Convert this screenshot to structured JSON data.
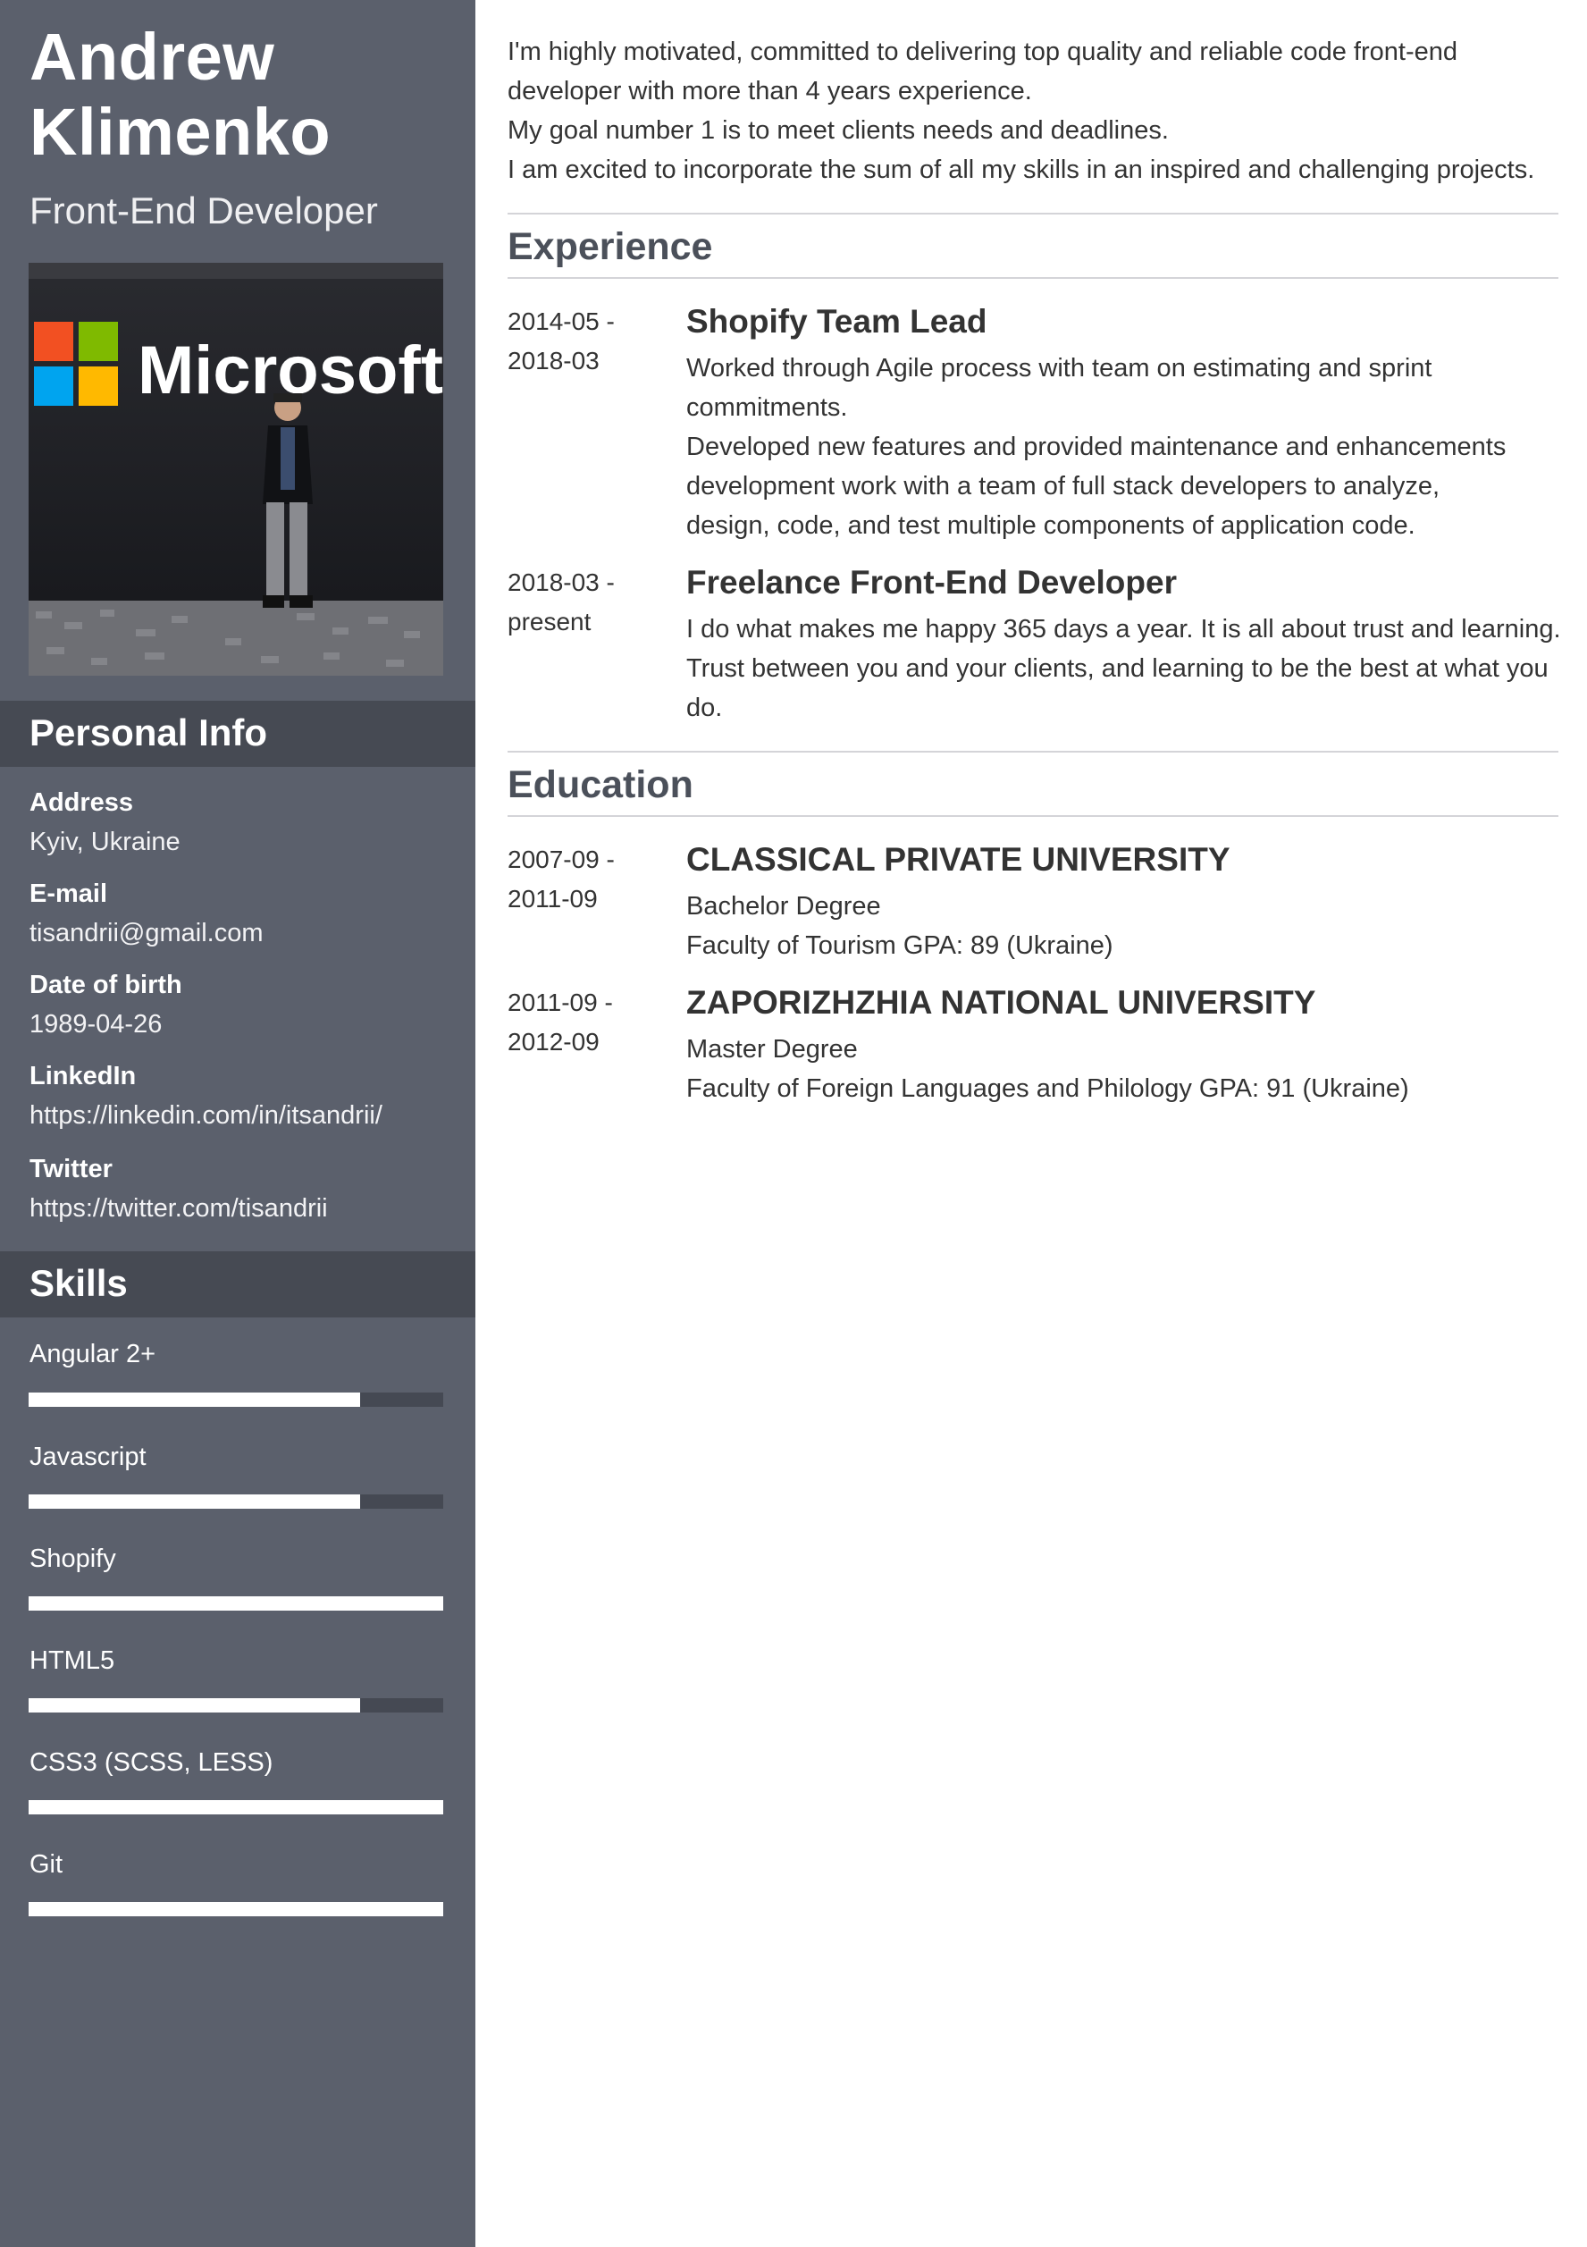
{
  "profile": {
    "name_line1": "Andrew",
    "name_line2": "Klimenko",
    "title": "Front-End Developer",
    "photo": {
      "description_icon": "profile-photo",
      "sign_text": "Microsoft",
      "logo_colors": [
        "#f25022",
        "#7fba00",
        "#00a4ef",
        "#ffb900"
      ]
    }
  },
  "personal_info": {
    "heading": "Personal Info",
    "items": [
      {
        "label": "Address",
        "value": "Kyiv, Ukraine"
      },
      {
        "label": "E-mail",
        "value": "tisandrii@gmail.com"
      },
      {
        "label": "Date of birth",
        "value": "1989-04-26"
      },
      {
        "label": "LinkedIn",
        "value": "https://linkedin.com/in/itsandrii/"
      },
      {
        "label": "Twitter",
        "value": "https://twitter.com/tisandrii"
      }
    ]
  },
  "skills": {
    "heading": "Skills",
    "items": [
      {
        "name": "Angular 2+",
        "level": 0.8
      },
      {
        "name": "Javascript",
        "level": 0.8
      },
      {
        "name": "Shopify",
        "level": 1.0
      },
      {
        "name": "HTML5",
        "level": 0.8
      },
      {
        "name": "CSS3 (SCSS, LESS)",
        "level": 1.0
      },
      {
        "name": "Git",
        "level": 1.0
      }
    ]
  },
  "summary": {
    "lines": [
      "I'm highly motivated, committed to delivering top quality and reliable code front-end",
      "developer with more than 4 years experience.",
      "My goal number 1 is to meet clients needs and deadlines.",
      "I am excited to incorporate the sum of all my skills in an inspired and challenging projects."
    ]
  },
  "experience": {
    "heading": "Experience",
    "entries": [
      {
        "date_line1": "2014-05 -",
        "date_line2": "2018-03",
        "title": "Shopify Team Lead",
        "lines": [
          "Worked through Agile process with team on estimating and sprint",
          "commitments.",
          "Developed new features and provided maintenance and enhancements",
          "development work with a team of full stack developers to analyze,",
          "design, code, and test multiple components of application code."
        ]
      },
      {
        "date_line1": "2018-03 -",
        "date_line2": "present",
        "title": "Freelance Front-End Developer",
        "lines": [
          "I do what makes me happy 365 days a year. It is all about trust and learning.",
          "Trust between you and your clients, and learning to be the best at what you",
          "do."
        ]
      }
    ]
  },
  "education": {
    "heading": "Education",
    "entries": [
      {
        "date_line1": "2007-09 -",
        "date_line2": "2011-09",
        "title": "CLASSICAL PRIVATE UNIVERSITY",
        "lines": [
          "Bachelor Degree",
          "Faculty of Tourism GPA: 89 (Ukraine)"
        ]
      },
      {
        "date_line1": "2011-09 -",
        "date_line2": "2012-09",
        "title": "ZAPORIZHZHIA NATIONAL UNIVERSITY",
        "lines": [
          "Master Degree",
          "Faculty of Foreign Languages and Philology GPA: 91 (Ukraine)"
        ]
      }
    ]
  }
}
